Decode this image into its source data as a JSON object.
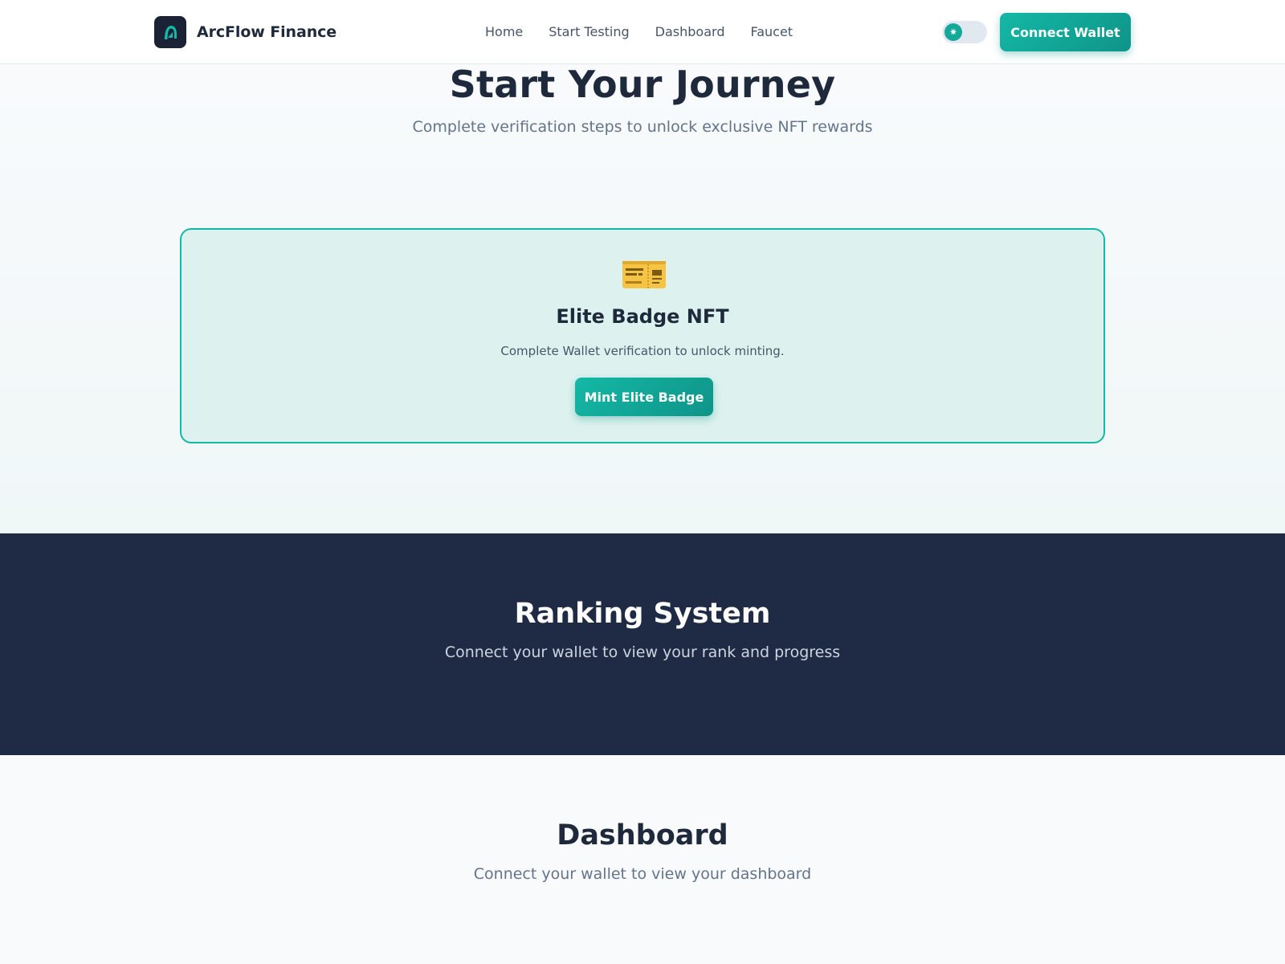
{
  "navbar": {
    "brand_name": "ArcFlow Finance",
    "logo_icon": "arc-logo-icon",
    "links": [
      {
        "label": "Home"
      },
      {
        "label": "Start Testing"
      },
      {
        "label": "Dashboard"
      },
      {
        "label": "Faucet"
      }
    ],
    "theme_toggle": {
      "icon": "sun-icon",
      "glyph": "✷",
      "state": "light"
    },
    "connect_label": "Connect Wallet"
  },
  "journey": {
    "title": "Start Your Journey",
    "subtitle": "Complete verification steps to unlock exclusive NFT rewards",
    "card": {
      "icon": "ticket-icon",
      "title": "Elite Badge NFT",
      "description": "Complete Wallet verification to unlock minting.",
      "button_label": "Mint Elite Badge"
    }
  },
  "ranking": {
    "title": "Ranking System",
    "subtitle": "Connect your wallet to view your rank and progress"
  },
  "dashboard": {
    "title": "Dashboard",
    "subtitle": "Connect your wallet to view your dashboard"
  },
  "colors": {
    "accent": "#14b8a6",
    "accent_dark": "#0f9488",
    "navy": "#1f2a44",
    "text": "#1e293b",
    "muted": "#64748b"
  }
}
